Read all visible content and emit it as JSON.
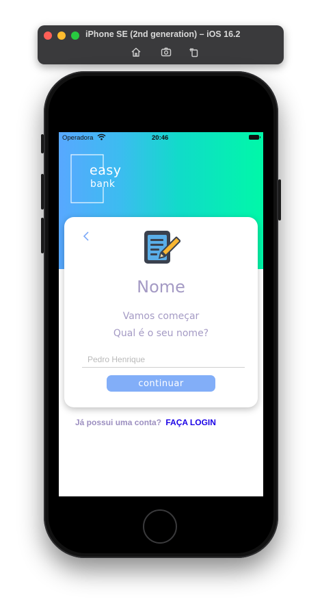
{
  "simulator": {
    "title": "iPhone SE (2nd generation) – iOS 16.2",
    "tools": [
      "home-icon",
      "screenshot-icon",
      "rotate-icon"
    ]
  },
  "status_bar": {
    "carrier": "Operadora",
    "time": "20:46"
  },
  "logo": {
    "line1": "easy",
    "line2": "bank"
  },
  "card": {
    "back_icon": "chevron-left-icon",
    "form_icon": "form-edit-icon",
    "title": "Nome",
    "subtitle_1": "Vamos começar",
    "subtitle_2": "Qual é o seu nome?",
    "name_input": {
      "placeholder": "Pedro Henrique",
      "value": ""
    },
    "continue_label": "continuar"
  },
  "login": {
    "question": "Já possui uma conta?",
    "link": "FAÇA LOGIN"
  },
  "colors": {
    "gradient_start": "#58a8ff",
    "gradient_end": "#00f8a8",
    "title_text": "#a49ac4",
    "button": "#82aef8",
    "login_link": "#1a00e6"
  }
}
